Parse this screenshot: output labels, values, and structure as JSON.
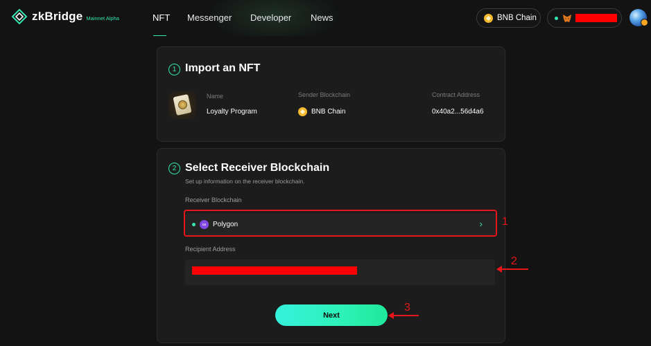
{
  "header": {
    "brand": "zkBridge",
    "brand_sub": "Mainnet Alpha",
    "nav": [
      {
        "label": "NFT",
        "active": true
      },
      {
        "label": "Messenger"
      },
      {
        "label": "Developer"
      },
      {
        "label": "News"
      }
    ],
    "chain_label": "BNB Chain",
    "wallet_icon": "metamask-fox-icon"
  },
  "import": {
    "step": "1",
    "title": "Import an NFT",
    "columns": {
      "name": "Name",
      "sender": "Sender Blockchain",
      "contract": "Contract Address"
    },
    "nft_name": "Loyalty Program",
    "sender_chain": "BNB Chain",
    "contract_address": "0x40a2...56d4a6"
  },
  "receiver": {
    "step": "2",
    "title": "Select Receiver Blockchain",
    "subtitle": "Set up information on the receiver blockchain.",
    "chain_label": "Receiver Blockchain",
    "chain_value": "Polygon",
    "address_label": "Recipient Address",
    "next_label": "Next"
  },
  "annotations": [
    "1",
    "2",
    "3"
  ],
  "colors": {
    "accent": "#34e7b3",
    "background": "#121312",
    "card": "#1b1c1b",
    "annotation": "#e8161b",
    "redaction": "#ff0000"
  }
}
